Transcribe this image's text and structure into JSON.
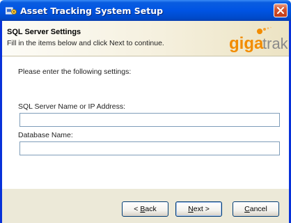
{
  "window": {
    "title": "Asset Tracking System Setup"
  },
  "banner": {
    "title": "SQL Server Settings",
    "subtitle": "Fill in the items below and click Next to continue.",
    "logo_text_g": "giga",
    "logo_text_trak": "trak"
  },
  "form": {
    "prompt": "Please enter the following settings:",
    "server_label": "SQL Server Name or IP Address:",
    "server_value": "",
    "db_label": "Database Name:",
    "db_value": ""
  },
  "buttons": {
    "back_prefix": "< ",
    "back_mnemonic": "B",
    "back_rest": "ack",
    "next_mnemonic": "N",
    "next_rest": "ext >",
    "cancel_mnemonic": "C",
    "cancel_rest": "ancel"
  },
  "colors": {
    "titlebar": "#0054e3",
    "logo_orange": "#f28c00",
    "logo_grey": "#8a8a8a"
  }
}
